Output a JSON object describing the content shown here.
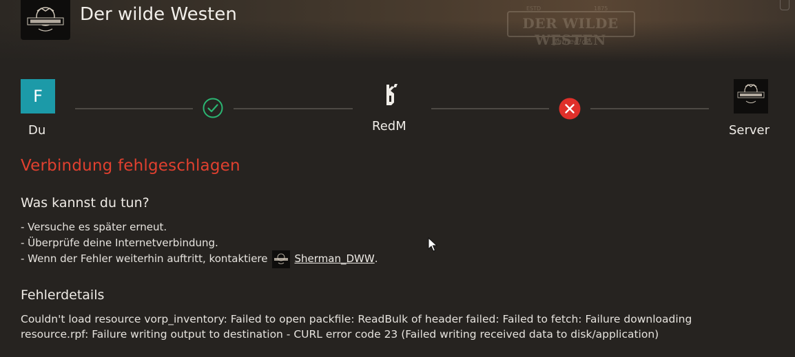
{
  "header": {
    "title": "Der wilde Westen",
    "watermark": {
      "brand": "DER WILDE WESTEN",
      "estd": "ESTD",
      "year": "1875",
      "sub": "gamed!de"
    }
  },
  "connection": {
    "you_initial": "F",
    "you_label": "Du",
    "platform_label": "RedM",
    "server_label": "Server",
    "step1_status": "success",
    "step2_status": "error",
    "colors": {
      "avatar": "#1c9aa8",
      "success": "#2bb673",
      "error": "#e0302a"
    }
  },
  "status": {
    "title": "Verbindung fehlgeschlagen",
    "color": "#e0402f"
  },
  "help": {
    "heading": "Was kannst du tun?",
    "tip1": "- Versuche es später erneut.",
    "tip2": "- Überprüfe deine Internetverbindung.",
    "tip3_prefix": "- Wenn der Fehler weiterhin auftritt, kontaktiere",
    "contact_name": "Sherman_DWW",
    "tip3_suffix": "."
  },
  "details": {
    "heading": "Fehlerdetails",
    "message": "Couldn't load resource vorp_inventory: Failed to open packfile: ReadBulk of header failed: Failed to fetch: Failure downloading resource.rpf: Failure writing output to destination - CURL error code 23 (Failed writing received data to disk/application)"
  }
}
